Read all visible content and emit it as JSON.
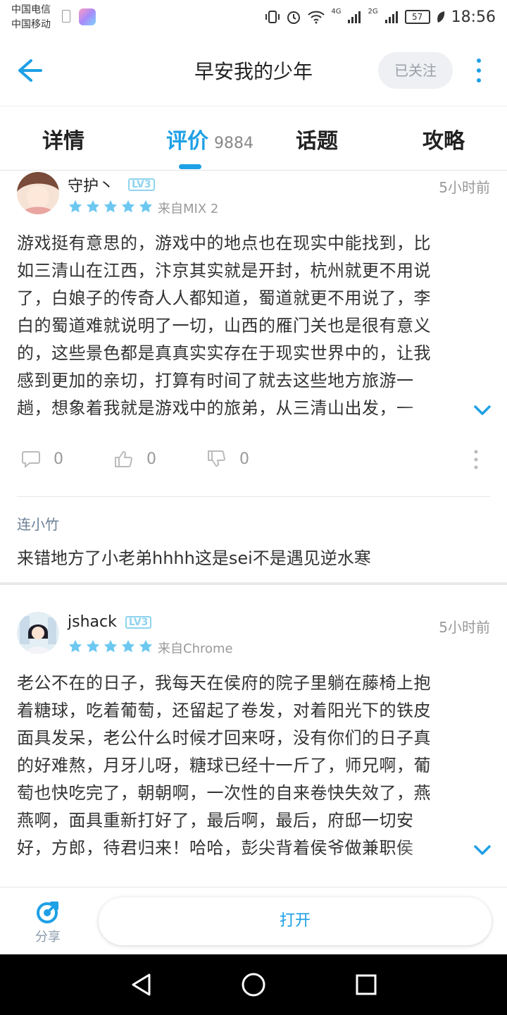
{
  "status_bar": {
    "carrier1": "中国电信",
    "carrier2": "中国移动",
    "net1": "4G",
    "net2": "2G",
    "battery": "57",
    "time": "18:56"
  },
  "header": {
    "title": "早安我的少年",
    "follow_label": "已关注"
  },
  "tabs": [
    {
      "label": "详情",
      "active": false
    },
    {
      "label": "评价",
      "count": "9884",
      "active": true
    },
    {
      "label": "话题",
      "active": false
    },
    {
      "label": "攻略",
      "active": false
    }
  ],
  "reviews": [
    {
      "username": "守护丶",
      "level": "LV3",
      "time": "5小时前",
      "rating": 5,
      "source": "来自MIX 2",
      "lines": [
        "游戏挺有意思的，游戏中的地点也在现实中能找到，比",
        "如三清山在江西，汴京其实就是开封，杭州就更不用说",
        "了，白娘子的传奇人人都知道，蜀道就更不用说了，李",
        "白的蜀道难就说明了一切，山西的雁门关也是很有意义",
        "的，这些景色都是真真实实存在于现实世界中的，让我",
        "感到更加的亲切，打算有时间了就去这些地方旅游一",
        "趟，想象着我就是游戏中的旅弟，从三清山出发，一"
      ],
      "comments": "0",
      "likes": "0",
      "dislikes": "0",
      "reply": {
        "name": "连小竹",
        "text": "来错地方了小老弟hhhh这是sei不是遇见逆水寒"
      }
    },
    {
      "username": "jshack",
      "level": "LV3",
      "time": "5小时前",
      "rating": 5,
      "source": "来自Chrome",
      "lines": [
        "老公不在的日子，我每天在侯府的院子里躺在藤椅上抱",
        "着糖球，吃着葡萄，还留起了卷发，对着阳光下的铁皮",
        "面具发呆，老公什么时候才回来呀，没有你们的日子真",
        "的好难熬，月牙儿呀，糖球已经十一斤了，师兄啊，葡",
        "萄也快吃完了，朝朝啊，一次性的自来卷快失效了，燕",
        "燕啊，面具重新打好了，最后啊，最后，府邸一切安",
        "好，方郎，待君归来！哈哈，彭尖背着侯爷做兼职侯"
      ]
    }
  ],
  "bottom_bar": {
    "share_label": "分享",
    "open_label": "打开"
  },
  "colors": {
    "accent": "#1ea0e6",
    "star": "#6cc8f0"
  }
}
